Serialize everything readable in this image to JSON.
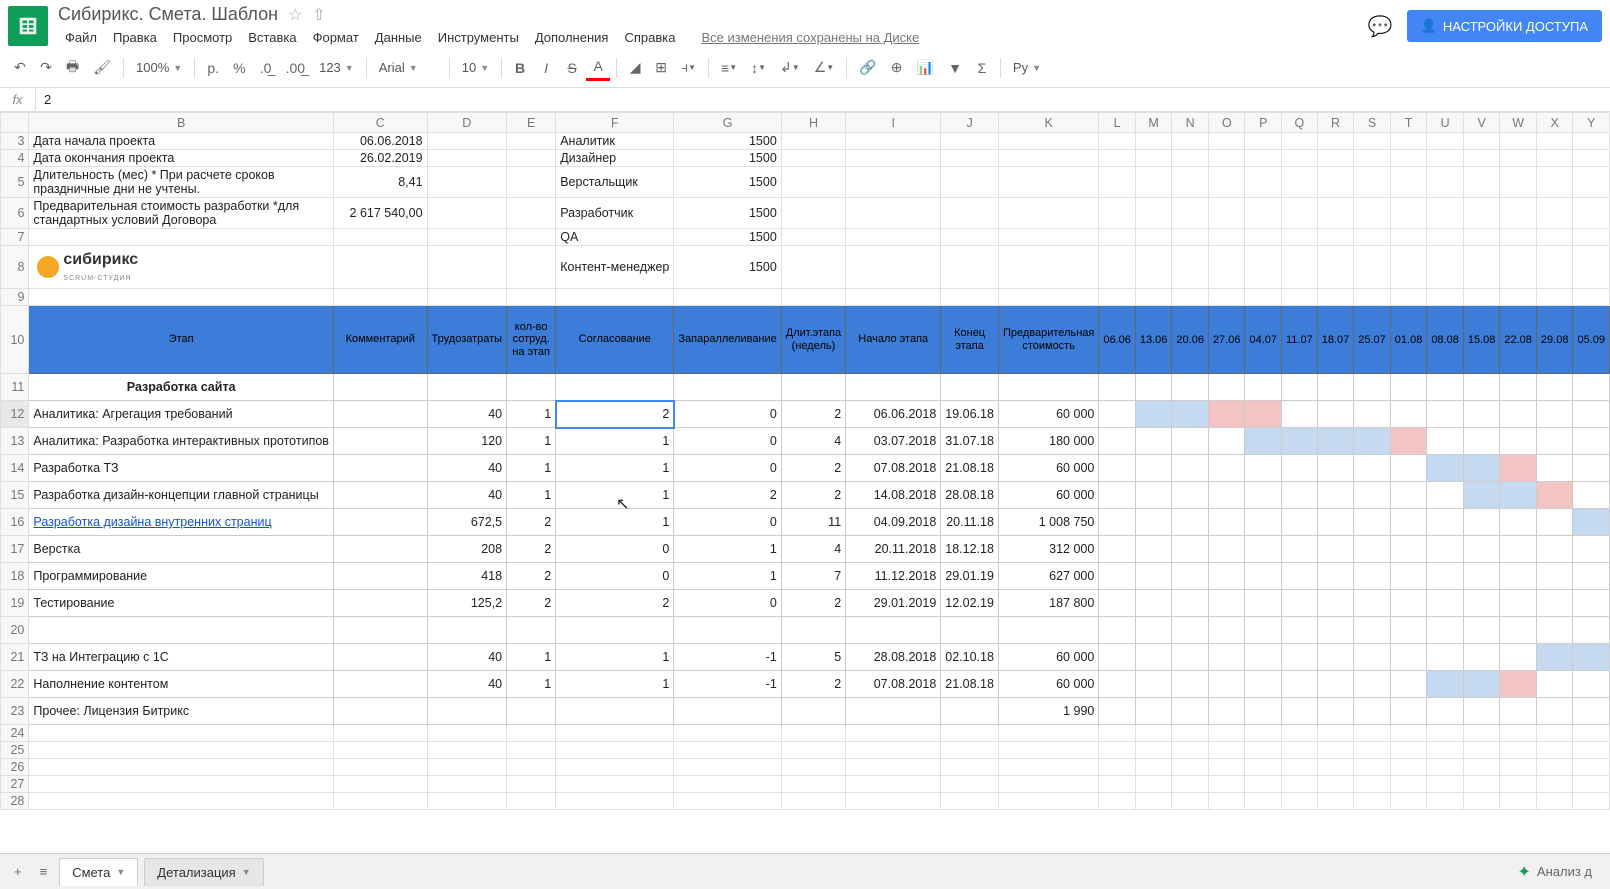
{
  "doc": {
    "title": "Сибирикс. Смета. Шаблон"
  },
  "menu": {
    "file": "Файл",
    "edit": "Правка",
    "view": "Просмотр",
    "insert": "Вставка",
    "format": "Формат",
    "data": "Данные",
    "tools": "Инструменты",
    "addons": "Дополнения",
    "help": "Справка",
    "save_status": "Все изменения сохранены на Диске"
  },
  "share": {
    "label": "НАСТРОЙКИ ДОСТУПА"
  },
  "toolbar": {
    "zoom": "100%",
    "currency": "р.",
    "percent": "%",
    "dec_less": ",0←",
    "dec_more": ",00→",
    "num_fmt": "123",
    "font": "Arial",
    "size": "10",
    "lang": "Ру"
  },
  "formula": {
    "value": "2"
  },
  "columns": [
    "",
    "B",
    "C",
    "D",
    "E",
    "F",
    "G",
    "H",
    "I",
    "J",
    "K",
    "L",
    "M",
    "N",
    "O",
    "P",
    "Q",
    "R",
    "S",
    "T",
    "U",
    "V",
    "W",
    "X",
    "Y"
  ],
  "rows_top": [
    {
      "n": "3",
      "b": "Дата начала проекта",
      "c": "06.06.2018",
      "f": "Аналитик",
      "g": "1500"
    },
    {
      "n": "4",
      "b": "Дата окончания проекта",
      "c": "26.02.2019",
      "f": "Дизайнер",
      "g": "1500"
    },
    {
      "n": "5",
      "b": "Длительность (мес)\n* При расчете сроков праздничные дни не учтены.",
      "c": "8,41",
      "f": "Верстальщик",
      "g": "1500"
    },
    {
      "n": "6",
      "b": "Предварительная стоимость разработки\n*для стандартных условий Договора",
      "c": "2 617 540,00",
      "f": "Разработчик",
      "g": "1500"
    },
    {
      "n": "7",
      "b": "",
      "c": "",
      "f": "QA",
      "g": "1500"
    },
    {
      "n": "8",
      "b": "LOGO",
      "c": "",
      "f": "Контент-менеджер",
      "g": "1500"
    },
    {
      "n": "9",
      "b": "",
      "c": "",
      "f": "",
      "g": ""
    }
  ],
  "brand": {
    "name": "сибирикс",
    "sub": "SCRUM-СТУДИЯ"
  },
  "header": {
    "B": "Этап",
    "C": "Комментарий",
    "D": "Трудозатраты",
    "E": "кол-во сотруд. на этап",
    "F": "Согласование",
    "G": "Запараллеливание",
    "H": "Длит.этапа (недель)",
    "I": "Начало этапа",
    "J": "Конец этапа",
    "K": "Предварительная стоимость",
    "dates": [
      "06.06",
      "13.06",
      "20.06",
      "27.06",
      "04.07",
      "11.07",
      "18.07",
      "25.07",
      "01.08",
      "08.08",
      "15.08",
      "22.08",
      "29.08",
      "05.09"
    ]
  },
  "section": {
    "title": "Разработка сайта"
  },
  "data_rows": [
    {
      "n": "12",
      "b": "Аналитика: Агрегация требований",
      "d": "40",
      "e": "1",
      "f": "2",
      "g": "0",
      "h": "2",
      "i": "06.06.2018",
      "j": "19.06.18",
      "k": "60 000",
      "gantt": [
        "",
        "b",
        "b",
        "r",
        "r",
        "",
        "",
        "",
        "",
        "",
        "",
        "",
        "",
        ""
      ],
      "selected_f": true
    },
    {
      "n": "13",
      "b": "Аналитика: Разработка интерактивных прототипов",
      "d": "120",
      "e": "1",
      "f": "1",
      "g": "0",
      "h": "4",
      "i": "03.07.2018",
      "j": "31.07.18",
      "k": "180 000",
      "gantt": [
        "",
        "",
        "",
        "",
        "b",
        "b",
        "b",
        "b",
        "r",
        "",
        "",
        "",
        "",
        ""
      ]
    },
    {
      "n": "14",
      "b": "Разработка ТЗ",
      "d": "40",
      "e": "1",
      "f": "1",
      "g": "0",
      "h": "2",
      "i": "07.08.2018",
      "j": "21.08.18",
      "k": "60 000",
      "gantt": [
        "",
        "",
        "",
        "",
        "",
        "",
        "",
        "",
        "",
        "b",
        "b",
        "r",
        "",
        ""
      ]
    },
    {
      "n": "15",
      "b": "Разработка дизайн-концепции главной страницы",
      "d": "40",
      "e": "1",
      "f": "1",
      "g": "2",
      "h": "2",
      "i": "14.08.2018",
      "j": "28.08.18",
      "k": "60 000",
      "gantt": [
        "",
        "",
        "",
        "",
        "",
        "",
        "",
        "",
        "",
        "",
        "b",
        "b",
        "r",
        ""
      ]
    },
    {
      "n": "16",
      "b": "Разработка дизайна внутренних страниц",
      "d": "672,5",
      "e": "2",
      "f": "1",
      "g": "0",
      "h": "11",
      "i": "04.09.2018",
      "j": "20.11.18",
      "k": "1 008 750",
      "gantt": [
        "",
        "",
        "",
        "",
        "",
        "",
        "",
        "",
        "",
        "",
        "",
        "",
        "",
        "b"
      ],
      "link": true
    },
    {
      "n": "17",
      "b": "Верстка",
      "d": "208",
      "e": "2",
      "f": "0",
      "g": "1",
      "h": "4",
      "i": "20.11.2018",
      "j": "18.12.18",
      "k": "312 000",
      "gantt": [
        "",
        "",
        "",
        "",
        "",
        "",
        "",
        "",
        "",
        "",
        "",
        "",
        "",
        ""
      ]
    },
    {
      "n": "18",
      "b": "Программирование",
      "d": "418",
      "e": "2",
      "f": "0",
      "g": "1",
      "h": "7",
      "i": "11.12.2018",
      "j": "29.01.19",
      "k": "627 000",
      "gantt": [
        "",
        "",
        "",
        "",
        "",
        "",
        "",
        "",
        "",
        "",
        "",
        "",
        "",
        ""
      ]
    },
    {
      "n": "19",
      "b": "Тестирование",
      "d": "125,2",
      "e": "2",
      "f": "2",
      "g": "0",
      "h": "2",
      "i": "29.01.2019",
      "j": "12.02.19",
      "k": "187 800",
      "gantt": [
        "",
        "",
        "",
        "",
        "",
        "",
        "",
        "",
        "",
        "",
        "",
        "",
        "",
        ""
      ]
    },
    {
      "n": "20",
      "b": "",
      "d": "",
      "e": "",
      "f": "",
      "g": "",
      "h": "",
      "i": "",
      "j": "",
      "k": "",
      "gantt": [
        "",
        "",
        "",
        "",
        "",
        "",
        "",
        "",
        "",
        "",
        "",
        "",
        "",
        ""
      ]
    },
    {
      "n": "21",
      "b": "ТЗ на Интеграцию с 1С",
      "d": "40",
      "e": "1",
      "f": "1",
      "g": "-1",
      "h": "5",
      "i": "28.08.2018",
      "j": "02.10.18",
      "k": "60 000",
      "gantt": [
        "",
        "",
        "",
        "",
        "",
        "",
        "",
        "",
        "",
        "",
        "",
        "",
        "b",
        "b"
      ]
    },
    {
      "n": "22",
      "b": "Наполнение контентом",
      "d": "40",
      "e": "1",
      "f": "1",
      "g": "-1",
      "h": "2",
      "i": "07.08.2018",
      "j": "21.08.18",
      "k": "60 000",
      "gantt": [
        "",
        "",
        "",
        "",
        "",
        "",
        "",
        "",
        "",
        "b",
        "b",
        "r",
        "",
        ""
      ]
    },
    {
      "n": "23",
      "b": "Прочее: Лицензия Битрикс",
      "d": "",
      "e": "",
      "f": "",
      "g": "",
      "h": "",
      "i": "",
      "j": "",
      "k": "1 990",
      "gantt": [
        "",
        "",
        "",
        "",
        "",
        "",
        "",
        "",
        "",
        "",
        "",
        "",
        "",
        ""
      ]
    }
  ],
  "empty_rows": [
    "24",
    "25",
    "26",
    "27",
    "28"
  ],
  "tabs": {
    "sheet1": "Смета",
    "sheet2": "Детализация",
    "explore": "Анализ д"
  }
}
